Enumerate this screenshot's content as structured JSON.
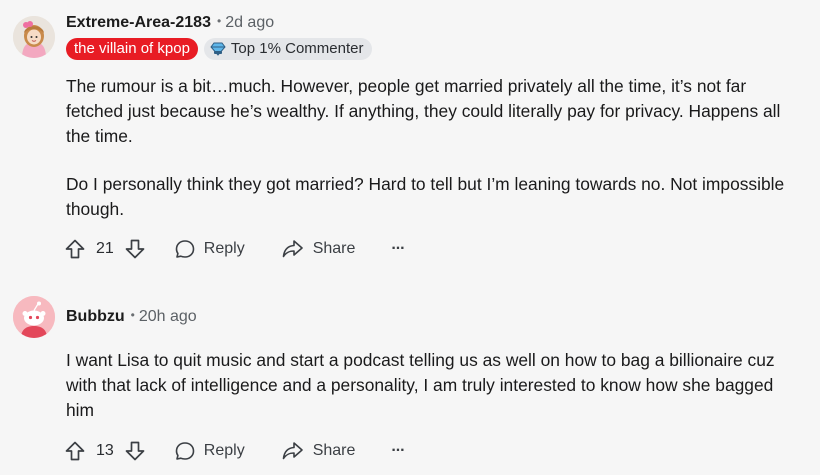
{
  "comments": [
    {
      "author": "Extreme-Area-2183",
      "separator": "•",
      "time": "2d ago",
      "flair_text": "the villain of kpop",
      "badge_text": "Top 1% Commenter",
      "paragraphs": [
        "The rumour is a bit…much. However, people get married privately all the time, it’s not far fetched just because he’s wealthy. If anything, they could literally pay for privacy. Happens all the time.",
        "Do I personally think they got married? Hard to tell but I’m leaning towards no. Not impossible though."
      ],
      "votes": "21",
      "reply_label": "Reply",
      "share_label": "Share",
      "more_label": "···"
    },
    {
      "author": "Bubbzu",
      "separator": "•",
      "time": "20h ago",
      "paragraphs": [
        "I want Lisa to quit music and start a podcast telling us as well on how to bag a billionaire cuz with that lack of intelligence and a personality, I am truly interested to know how she bagged him"
      ],
      "votes": "13",
      "reply_label": "Reply",
      "share_label": "Share",
      "more_label": "···"
    }
  ],
  "colors": {
    "background": "#f6f6f6",
    "flair_red": "#e81c24",
    "badge_gray": "#e4e6e9",
    "meta_gray": "#5c6166"
  },
  "icons": [
    "upvote-icon",
    "downvote-icon",
    "reply-bubble-icon",
    "share-arrow-icon",
    "more-options-icon",
    "diamond-badge-icon",
    "avatar-icon"
  ]
}
